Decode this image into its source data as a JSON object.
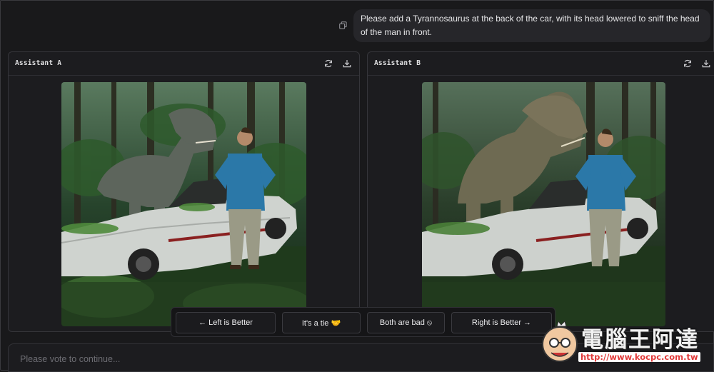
{
  "prompt": {
    "text": "Please add a Tyrannosaurus at the back of the car, with its head lowered to sniff the head of the man in front.",
    "copy_icon": "copy-icon"
  },
  "panels": [
    {
      "title": "Assistant A",
      "regenerate_icon": "refresh-icon",
      "download_icon": "download-icon"
    },
    {
      "title": "Assistant B",
      "regenerate_icon": "refresh-icon",
      "download_icon": "download-icon"
    }
  ],
  "vote": {
    "left_label": "← Left is Better",
    "tie_label": "It's a tie 🤝",
    "bad_label": "Both are bad ⦸",
    "right_label": "Right is Better →"
  },
  "input": {
    "placeholder": "Please vote to continue..."
  },
  "watermark": {
    "title": "電腦王阿達",
    "url": "http://www.kocpc.com.tw"
  },
  "colors": {
    "background": "#19191b",
    "panel": "#1c1c1f",
    "border": "#35353a",
    "text": "#e6e6e8"
  }
}
